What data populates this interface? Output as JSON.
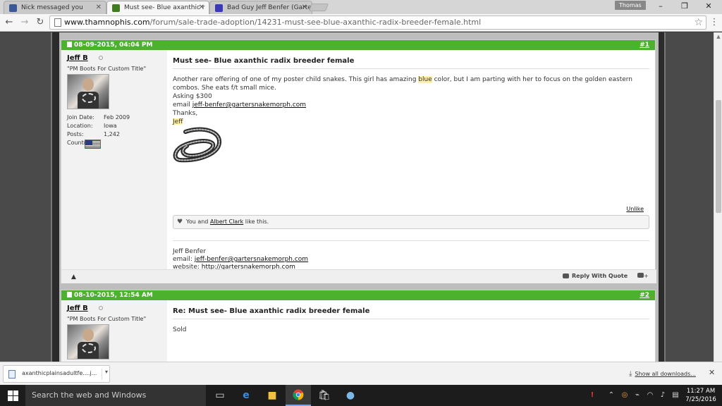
{
  "browser": {
    "tabs": [
      {
        "title": "Nick messaged you",
        "favicon_color": "#3b5998"
      },
      {
        "title": "Must see- Blue axanthic r",
        "favicon_color": "#3f7d1e"
      },
      {
        "title": "Bad Guy Jeff Benfer (Garte",
        "favicon_color": "#3a3ab8"
      }
    ],
    "profile": "Thomas",
    "url_domain": "www.thamnophis.com",
    "url_path": "/forum/sale-trade-adoption/14231-must-see-blue-axanthic-radix-breeder-female.html",
    "window_minimize": "–",
    "window_restore": "❐",
    "window_close": "✕"
  },
  "posts": [
    {
      "date": "08-09-2015, 04:04 PM",
      "number": "#1",
      "username": "Jeff B",
      "user_title": "\"PM Boots For Custom Title\"",
      "stats": [
        {
          "label": "Join Date:",
          "value": "Feb 2009"
        },
        {
          "label": "Location:",
          "value": "Iowa"
        },
        {
          "label": "Posts:",
          "value": "1,242"
        },
        {
          "label": "Country:",
          "value": ""
        }
      ],
      "title": "Must see- Blue axanthic radix breeder female",
      "body_line1_before": "Another rare offering of one of my poster child snakes. This girl has amazing ",
      "body_highlight": "blue",
      "body_line1_after": " color, but I am parting with her to focus on the golden eastern combos. She eats f/t small mice.",
      "asking": "Asking $300",
      "email_label": "email ",
      "email": "jeff-benfer@gartersnakemorph.com",
      "thanks": "Thanks,",
      "signoff": "Jeff",
      "unlike": "Unlike",
      "likes_prefix": "You and ",
      "likes_user": "Albert Clark",
      "likes_suffix": " like this.",
      "sig_name": "Jeff Benfer",
      "sig_email_label": "email: ",
      "sig_email": "jeff-benfer@gartersnakemorph.com",
      "sig_website_label": "website: ",
      "sig_website": "http://gartersnakemorph.com",
      "reply_with_quote": "Reply With Quote",
      "multi_quote": "+"
    },
    {
      "date": "08-10-2015, 12:54 AM",
      "number": "#2",
      "username": "Jeff B",
      "user_title": "\"PM Boots For Custom Title\"",
      "title": "Re: Must see- Blue axanthic radix breeder female",
      "body": "Sold"
    }
  ],
  "download_shelf": {
    "file_name": "axanthicplainsadultfe....j...",
    "show_all": "Show all downloads...",
    "close": "✕"
  },
  "taskbar": {
    "search_placeholder": "Search the web and Windows",
    "time": "11:27 AM",
    "date": "7/25/2016"
  }
}
